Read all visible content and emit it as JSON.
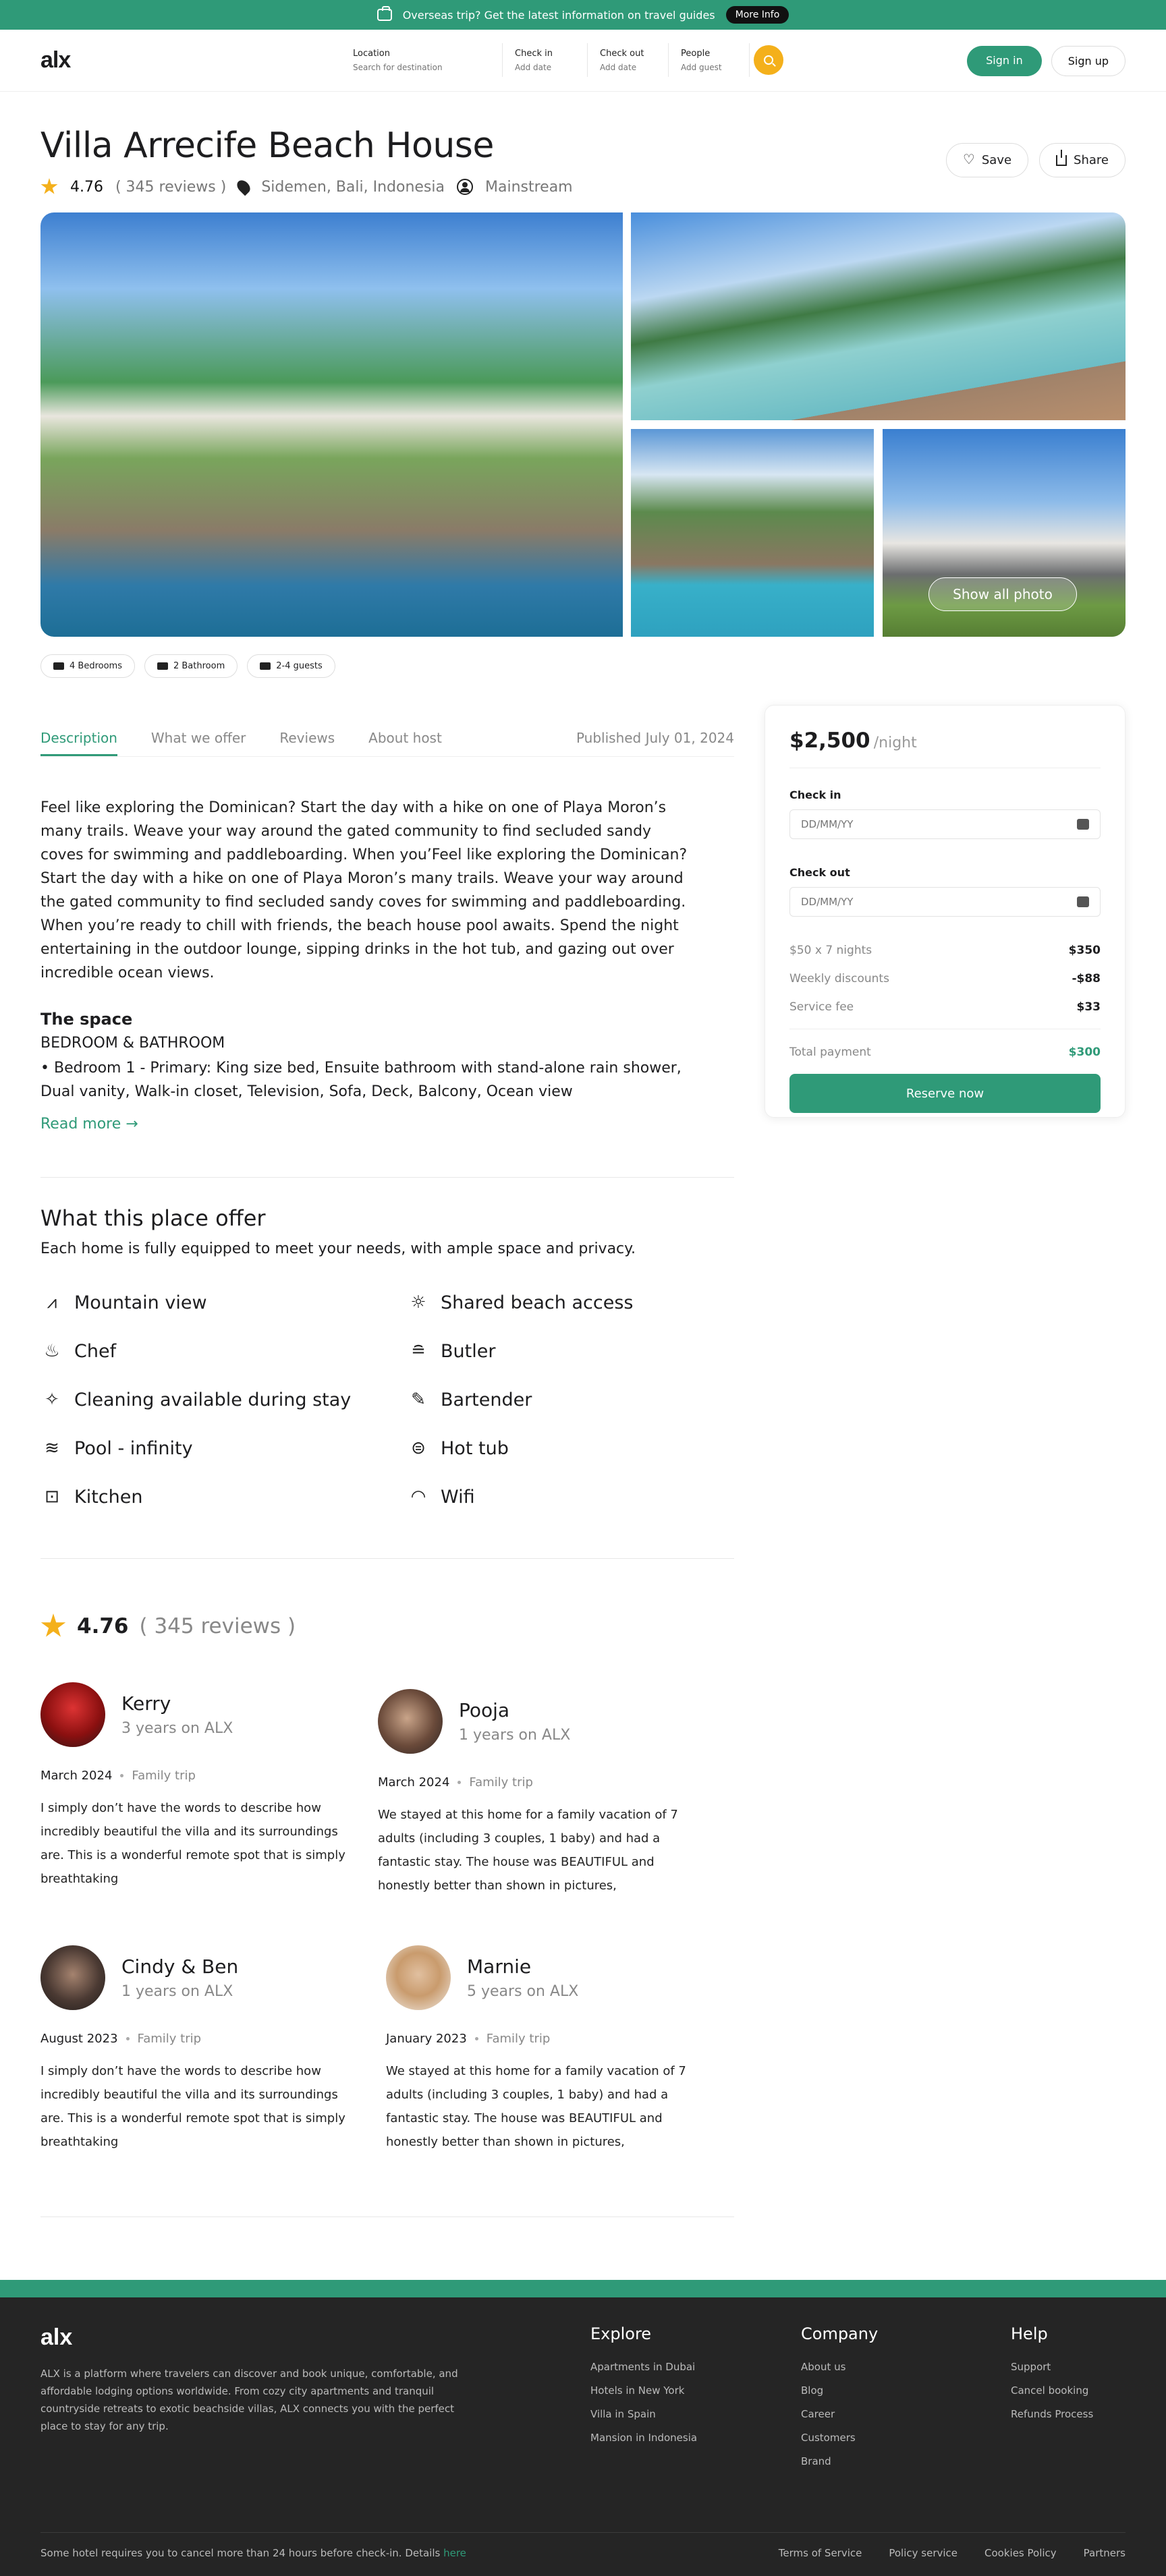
{
  "banner": {
    "text": "Overseas trip? Get the latest information on travel guides",
    "button": "More Info"
  },
  "header": {
    "logo": "alx",
    "search": [
      {
        "label": "Location",
        "placeholder": "Search for destination"
      },
      {
        "label": "Check in",
        "placeholder": "Add date"
      },
      {
        "label": "Check out",
        "placeholder": "Add date"
      },
      {
        "label": "People",
        "placeholder": "Add guest"
      }
    ],
    "sign_in": "Sign in",
    "sign_up": "Sign up"
  },
  "listing": {
    "title": "Villa Arrecife Beach House",
    "rating": "4.76",
    "reviews_count": "( 345 reviews )",
    "location": "Sidemen, Bali, Indonesia",
    "category": "Mainstream",
    "save": "Save",
    "share": "Share",
    "show_all_photo": "Show all photo",
    "features": [
      "4 Bedrooms",
      "2 Bathroom",
      "2-4 guests"
    ]
  },
  "tabs": {
    "items": [
      "Description",
      "What we offer",
      "Reviews",
      "About host"
    ],
    "published": "Published July 01, 2024"
  },
  "description": {
    "text": "Feel like exploring the Dominican? Start the day with a hike on one of Playa Moron’s many trails. Weave your way around the gated community to find secluded sandy coves for swimming and paddleboarding. When you’Feel like exploring the Dominican? Start the day with a hike on one of Playa Moron’s many trails. Weave your way around the gated community to find secluded sandy coves for swimming and paddleboarding. When you’re ready to chill with friends, the beach house pool awaits. Spend the night entertaining in the outdoor lounge, sipping drinks in the hot tub, and gazing out over incredible ocean views.",
    "space_title": "The space",
    "space_sub": "BEDROOM & BATHROOM",
    "space_body": "• Bedroom 1 - Primary: King size bed, Ensuite bathroom with stand-alone rain shower, Dual vanity, Walk-in closet, Television, Sofa, Deck, Balcony, Ocean view",
    "read_more": "Read more"
  },
  "offer": {
    "title": "What this place offer",
    "subtitle": "Each home is fully equipped to meet your needs, with ample space and privacy.",
    "amenities": [
      {
        "icon": "mountain-icon",
        "label": "Mountain view"
      },
      {
        "icon": "beach-icon",
        "label": "Shared beach access"
      },
      {
        "icon": "chef-icon",
        "label": "Chef"
      },
      {
        "icon": "butler-icon",
        "label": "Butler"
      },
      {
        "icon": "cleaning-icon",
        "label": "Cleaning available during stay"
      },
      {
        "icon": "bartender-icon",
        "label": "Bartender"
      },
      {
        "icon": "pool-icon",
        "label": "Pool - infinity"
      },
      {
        "icon": "hot-tub-icon",
        "label": "Hot tub"
      },
      {
        "icon": "kitchen-icon",
        "label": "Kitchen"
      },
      {
        "icon": "wifi-icon",
        "label": "Wifi"
      }
    ]
  },
  "reviews": {
    "rating": "4.76",
    "count": "( 345 reviews )",
    "items": [
      {
        "name": "Kerry",
        "tenure": "3 years on ALX",
        "date": "March 2024",
        "trip": "Family trip",
        "text": "I simply don’t have the words to describe how incredibly beautiful the villa and its surroundings are. This is a wonderful remote spot that is simply breathtaking"
      },
      {
        "name": "Pooja",
        "tenure": "1 years on ALX",
        "date": "March 2024",
        "trip": "Family trip",
        "text": "We stayed at this home for a family vacation of 7 adults (including 3 couples, 1 baby) and had a fantastic stay. The house was BEAUTIFUL and honestly better than shown in pictures,"
      },
      {
        "name": "Cindy & Ben",
        "tenure": "1 years on ALX",
        "date": "August 2023",
        "trip": "Family trip",
        "text": "I simply don’t have the words to describe how incredibly beautiful the villa and its surroundings are. This is a wonderful remote spot that is simply breathtaking"
      },
      {
        "name": "Marnie",
        "tenure": "5 years on ALX",
        "date": "January 2023",
        "trip": "Family trip",
        "text": "We stayed at this home for a family vacation of 7 adults (including 3 couples, 1 baby) and had a fantastic stay. The house was BEAUTIFUL and honestly better than shown in pictures,"
      }
    ]
  },
  "booking": {
    "price": "$2,500",
    "per": "/night",
    "check_in_label": "Check in",
    "check_out_label": "Check out",
    "date_placeholder": "DD/MM/YY",
    "rows": [
      {
        "k": "$50 x 7 nights",
        "v": "$350"
      },
      {
        "k": "Weekly discounts",
        "v": "-$88"
      },
      {
        "k": "Service fee",
        "v": "$33"
      }
    ],
    "total_label": "Total payment",
    "total_value": "$300",
    "reserve": "Reserve now"
  },
  "footer": {
    "logo": "alx",
    "about": "ALX is a platform where travelers can discover and book unique, comfortable, and affordable lodging options worldwide. From cozy city apartments and tranquil countryside retreats to exotic beachside villas, ALX connects you with the perfect place to stay for any trip.",
    "explore": {
      "title": "Explore",
      "links": [
        "Apartments in Dubai",
        "Hotels in New York",
        "Villa in Spain",
        "Mansion in Indonesia"
      ]
    },
    "company": {
      "title": "Company",
      "links": [
        "About us",
        "Blog",
        "Career",
        "Customers",
        "Brand"
      ]
    },
    "help": {
      "title": "Help",
      "links": [
        "Support",
        "Cancel booking",
        "Refunds Process"
      ]
    },
    "note": "Some hotel requires you to cancel more than 24 hours before check-in. Details ",
    "note_link": "here",
    "legal": [
      "Terms of Service",
      "Policy service",
      "Cookies Policy",
      "Partners"
    ]
  },
  "colors": {
    "brand": "#2f9a78",
    "accent": "#f4b01b",
    "footer": "#252525"
  }
}
